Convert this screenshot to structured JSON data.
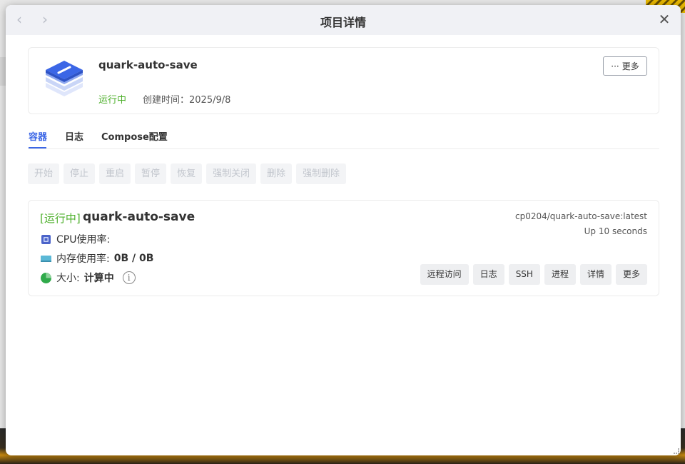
{
  "window": {
    "title": "项目详情",
    "close_symbol": "✕",
    "back_symbol": "‹",
    "forward_symbol": "›"
  },
  "project": {
    "name": "quark-auto-save",
    "status": "运行中",
    "created_label": "创建时间：",
    "created_date": "2025/9/8",
    "more_label": "更多",
    "more_icon": "ellipsis-icon"
  },
  "tabs": [
    {
      "label": "容器",
      "active": true
    },
    {
      "label": "日志",
      "active": false
    },
    {
      "label": "Compose配置",
      "active": false
    }
  ],
  "actions": [
    "开始",
    "停止",
    "重启",
    "暂停",
    "恢复",
    "强制关闭",
    "删除",
    "强制删除"
  ],
  "container": {
    "status": "[运行中]",
    "name": "quark-auto-save",
    "image": "cp0204/quark-auto-save:latest",
    "uptime": "Up 10 seconds",
    "cpu_label": "CPU使用率:",
    "cpu_value": "",
    "mem_label": "内存使用率:",
    "mem_value": "0B / 0B",
    "size_label": "大小:",
    "size_value": "计算中",
    "info_symbol": "i",
    "buttons": [
      "远程访问",
      "日志",
      "SSH",
      "进程",
      "详情",
      "更多"
    ]
  },
  "colors": {
    "accent": "#3b66e6",
    "running": "#4caf2a"
  }
}
